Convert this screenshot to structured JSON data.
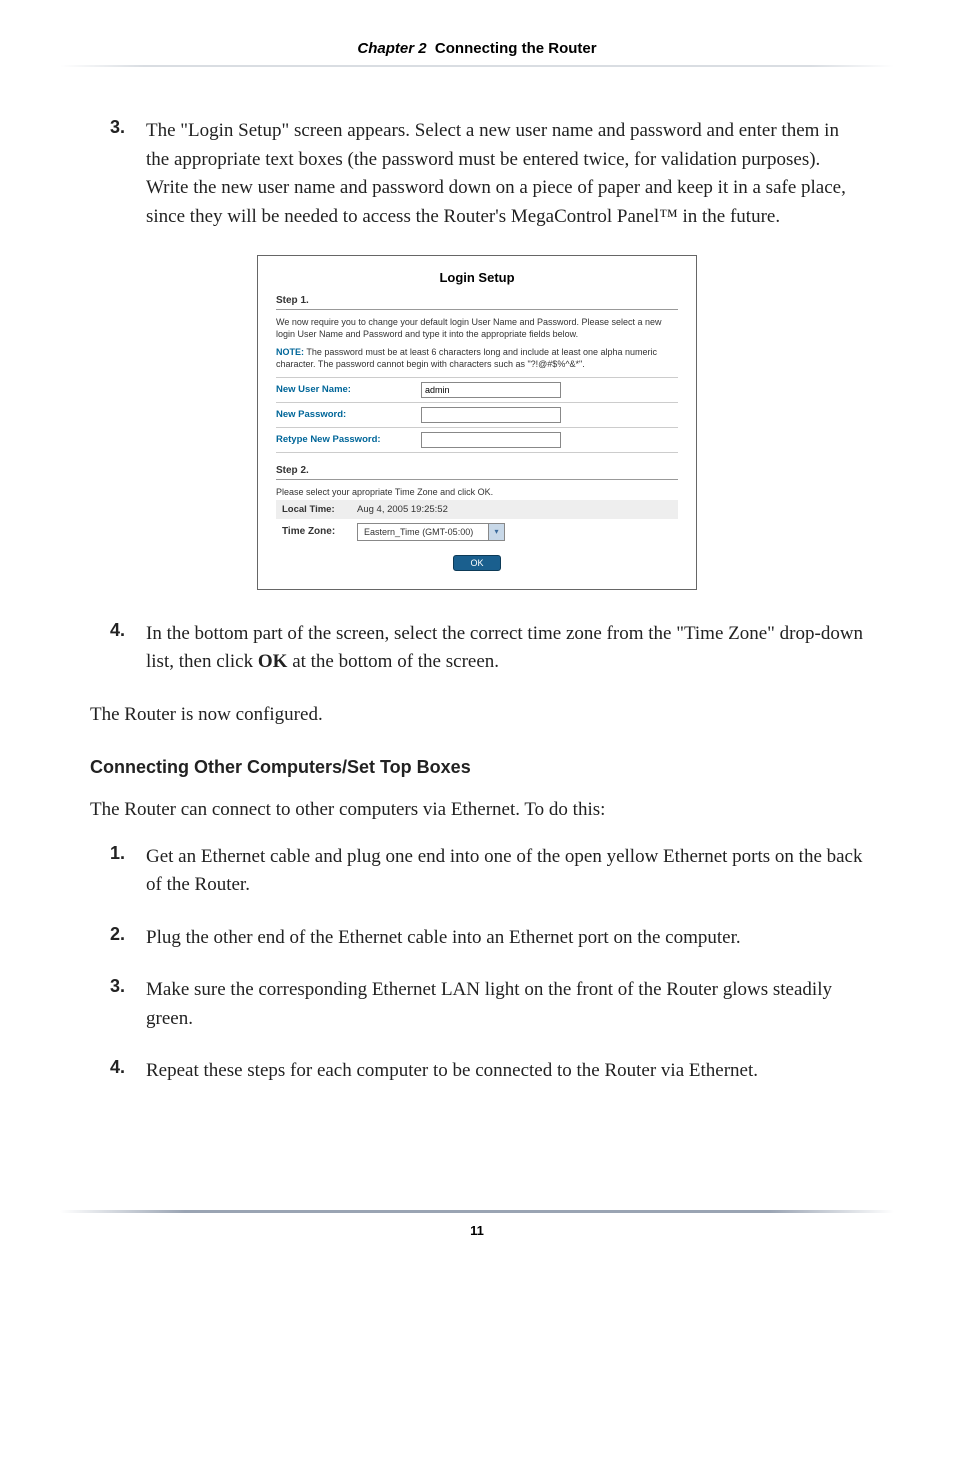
{
  "header": {
    "chapter_prefix": "Chapter 2",
    "chapter_title": "Connecting the Router"
  },
  "step3": {
    "num": "3.",
    "text": "The \"Login Setup\" screen appears. Select a new user name and password and enter them in the appropriate text boxes (the password must be entered twice, for validation purposes). Write the new user name and password down on a piece of paper and keep it in a safe place, since they will be needed to access the Router's MegaControl Panel™ in the future."
  },
  "screenshot": {
    "title": "Login Setup",
    "step1_label": "Step 1.",
    "intro_text": "We now require you to change your default login User Name and Password. Please select a new login User Name and Password and type it into the appropriate fields below.",
    "note_prefix": "NOTE:",
    "note_text": " The password must be at least 6 characters long and include at least one alpha numeric character. The password cannot begin with characters such as \"?!@#$%^&*\".",
    "user_label": "New User Name:",
    "user_value": "admin",
    "pass_label": "New Password:",
    "retype_label": "Retype New Password:",
    "step2_label": "Step 2.",
    "step2_text": "Please select your apropriate Time Zone and click OK.",
    "local_time_label": "Local Time:",
    "local_time_value": "Aug 4, 2005 19:25:52",
    "tz_label": "Time Zone:",
    "tz_value": "Eastern_Time (GMT-05:00)",
    "ok_label": "OK"
  },
  "step4": {
    "num": "4.",
    "text_before": "In the bottom part of the screen, select the correct time zone from the \"Time Zone\" drop-down list, then click ",
    "ok": "OK",
    "text_after": " at the bottom of the screen."
  },
  "configured_para": "The Router is now configured.",
  "section_heading": "Connecting Other Computers/Set Top Boxes",
  "section_intro": "The Router can connect to other computers via Ethernet. To do this:",
  "sub1": {
    "num": "1.",
    "text": "Get an Ethernet cable and plug one end into one of the open yellow Ethernet ports on the back of the Router."
  },
  "sub2": {
    "num": "2.",
    "text": "Plug the other end of the Ethernet cable into an Ethernet port on the computer."
  },
  "sub3": {
    "num": "3.",
    "text_before": "Make sure the corresponding Ethernet ",
    "lan": "LAN",
    "text_after": " light on the front of the Router glows steadily green."
  },
  "sub4": {
    "num": "4.",
    "text": "Repeat these steps for each computer to be connected to the Router via Ethernet."
  },
  "page_number": "11"
}
